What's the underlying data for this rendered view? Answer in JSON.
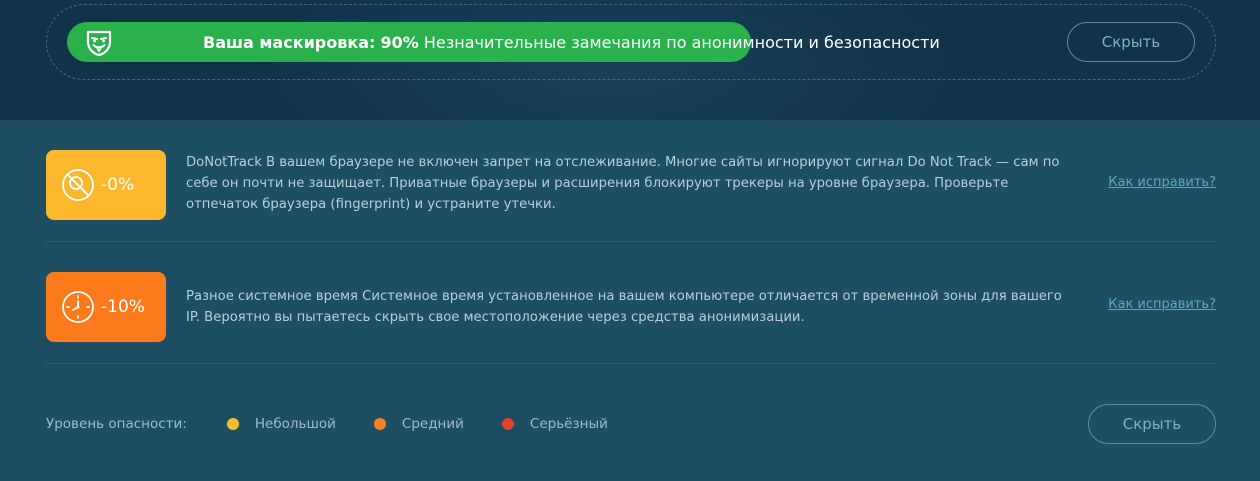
{
  "header": {
    "score_label": "Ваша маскировка:",
    "score_value": "90%",
    "score_description": "Незначительные замечания по анонимности и безопасности",
    "hide_button": "Скрыть",
    "icon": "mask-icon",
    "pill_color": "#2bb14c"
  },
  "issues": [
    {
      "penalty": "-0%",
      "severity_color": "#fbb82c",
      "icon": "no-tracking-icon",
      "text": "DoNotTrack В вашем браузере не включен запрет на отслеживание. Многие сайты игнорируют сигнал Do Not Track — сам по себе он почти не защищает. Приватные браузеры и расширения блокируют трекеры на уровне браузера. Проверьте отпечаток браузера (fingerprint) и устраните утечки.",
      "fix_link": "Как исправить?"
    },
    {
      "penalty": "-10%",
      "severity_color": "#fb7b1c",
      "icon": "clock-icon",
      "text": "Разное системное время Системное время установленное на вашем компьютере отличается от временной зоны для вашего IP. Вероятно вы пытаетесь скрыть свое местоположение через средства анонимизации.",
      "fix_link": "Как исправить?"
    }
  ],
  "legend": {
    "label": "Уровень опасности:",
    "items": [
      {
        "label": "Небольшой",
        "color": "#f7bd2c"
      },
      {
        "label": "Средний",
        "color": "#f7831f"
      },
      {
        "label": "Серьёзный",
        "color": "#e2442a"
      }
    ]
  },
  "footer": {
    "hide_button": "Скрыть"
  }
}
